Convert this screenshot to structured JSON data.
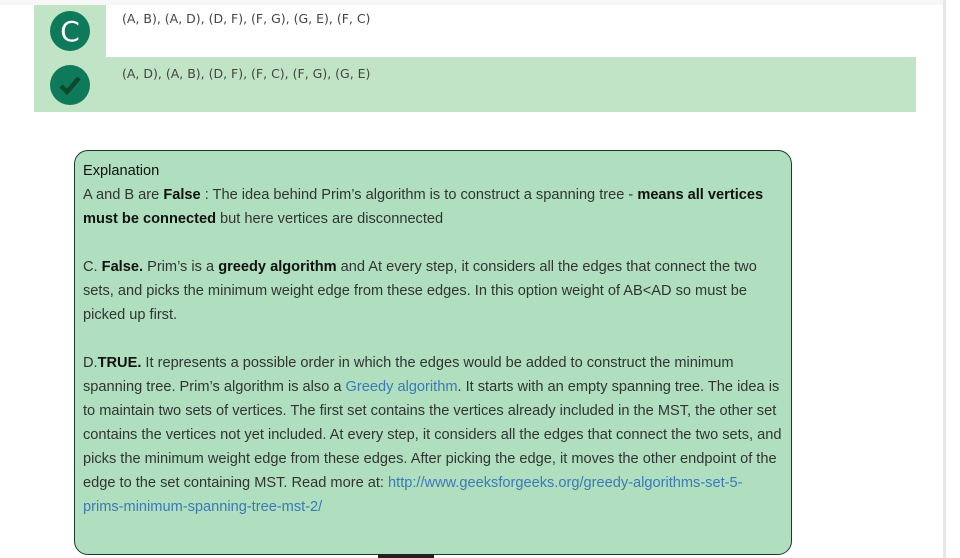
{
  "options": [
    {
      "marker": "C",
      "text": "(A, B), (A, D), (D, F), (F, G), (G, E), (F, C)",
      "correct": false
    },
    {
      "marker": "check-icon",
      "text": "(A, D), (A, B), (D, F), (F, C), (F, G), (G, E)",
      "correct": true
    }
  ],
  "explanation": {
    "title": "Explanation",
    "p1": {
      "a": "A and B are ",
      "b": "False",
      "c": "  : The idea behind Prim’s algorithm is to construct a spanning tree - ",
      "d": "means all vertices must be connected",
      "e": " but here vertices are disconnected"
    },
    "p2": {
      "a": "C. ",
      "b": "False.",
      "c": " Prim’s is a ",
      "d": "greedy algorithm",
      "e": " and At every step, it considers all the edges that connect the two sets, and picks the minimum weight edge from these edges. In this option weight of AB<AD so must be picked up first."
    },
    "p3": {
      "a": "D.",
      "b": "TRUE.",
      "c": " It represents a possible order in which the edges would be added to construct the minimum spanning tree. Prim’s algorithm is also a ",
      "link1": "Greedy algorithm",
      "d": ". It starts with an empty spanning tree. The idea is to maintain two sets of vertices. The first set contains the vertices already included in the MST, the other set contains the vertices not yet included. At every step, it considers all the edges that connect the two sets, and picks the minimum weight edge from these edges. After picking the edge, it moves the other endpoint of the edge to the set containing MST. Read more at: ",
      "link2": "http://www.geeksforgeeks.org/greedy-algorithms-set-5-prims-minimum-spanning-tree-mst-2/"
    }
  },
  "colors": {
    "accent": "#0f7a5a",
    "correct_bg": "#c0e4c5",
    "explanation_bg": "#afdfbf",
    "link": "#3c79b6"
  }
}
